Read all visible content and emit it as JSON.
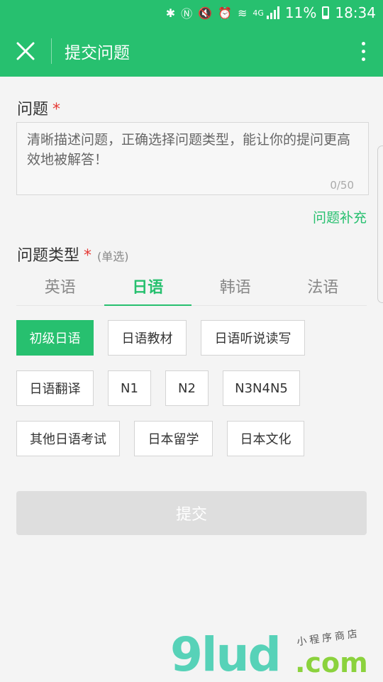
{
  "status_bar": {
    "icons": [
      "bluetooth-icon",
      "nfc-icon",
      "mute-icon",
      "alarm-icon",
      "wifi-icon",
      "signal-icon"
    ],
    "network": "4G",
    "battery": "11%",
    "time": "18:34"
  },
  "header": {
    "title": "提交问题",
    "close_icon": "close-icon",
    "more_icon": "more-vertical-icon"
  },
  "question": {
    "label": "问题",
    "required_mark": "*",
    "placeholder": "清晰描述问题，正确选择问题类型，能让你的提问更高效地被解答！",
    "value": "",
    "counter": "0/50"
  },
  "supplement_link": "问题补充",
  "question_type": {
    "label": "问题类型",
    "required_mark": "*",
    "hint": "(单选)"
  },
  "tabs": [
    {
      "label": "英语",
      "active": false
    },
    {
      "label": "日语",
      "active": true
    },
    {
      "label": "韩语",
      "active": false
    },
    {
      "label": "法语",
      "active": false
    }
  ],
  "categories": [
    {
      "label": "初级日语",
      "selected": true
    },
    {
      "label": "日语教材",
      "selected": false
    },
    {
      "label": "日语听说读写",
      "selected": false
    },
    {
      "label": "日语翻译",
      "selected": false
    },
    {
      "label": "N1",
      "selected": false
    },
    {
      "label": "N2",
      "selected": false
    },
    {
      "label": "N3N4N5",
      "selected": false
    },
    {
      "label": "其他日语考试",
      "selected": false
    },
    {
      "label": "日本留学",
      "selected": false
    },
    {
      "label": "日本文化",
      "selected": false
    }
  ],
  "submit_label": "提交",
  "colors": {
    "accent": "#27c06f",
    "required": "#e53935",
    "submit_disabled": "#dedede"
  },
  "watermark": {
    "logo": "9lud",
    "domain": ".com",
    "small_text": "小程序商店"
  }
}
